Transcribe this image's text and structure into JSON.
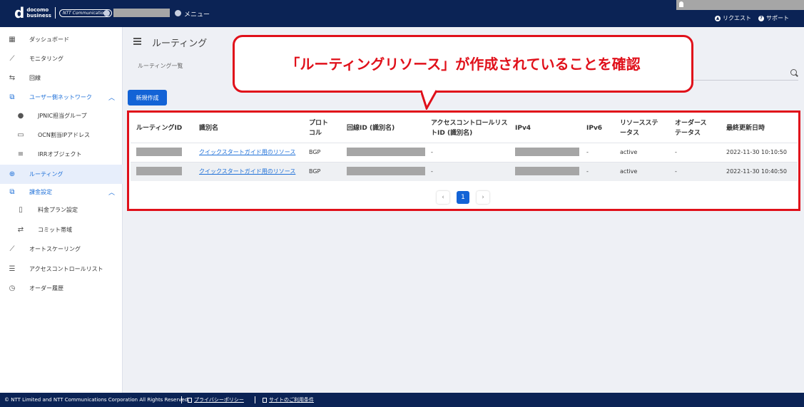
{
  "header": {
    "logo_main": "d",
    "logo_line1": "docomo",
    "logo_line2": "business",
    "logo_ntt": "NTT Communications",
    "menu_label": "メニュー",
    "request_label": "リクエスト",
    "support_label": "サポート"
  },
  "sidebar": {
    "items": [
      {
        "label": "ダッシュボード"
      },
      {
        "label": "モニタリング"
      },
      {
        "label": "回線"
      },
      {
        "label": "ユーザー側ネットワーク"
      },
      {
        "label": "JPNIC担当グループ"
      },
      {
        "label": "OCN割当IPアドレス"
      },
      {
        "label": "IRRオブジェクト"
      },
      {
        "label": "ルーティング"
      },
      {
        "label": "課金設定"
      },
      {
        "label": "料金プラン設定"
      },
      {
        "label": "コミット帯域"
      },
      {
        "label": "オートスケーリング"
      },
      {
        "label": "アクセスコントロールリスト"
      },
      {
        "label": "オーダー履歴"
      }
    ]
  },
  "page": {
    "title": "ルーティング",
    "breadcrumb": "ルーティング一覧",
    "new_button": "新規作成"
  },
  "table": {
    "headers": [
      "ルーティングID",
      "識別名",
      "プロトコル",
      "回線ID (識別名)",
      "アクセスコントロールリストID (識別名)",
      "IPv4",
      "IPv6",
      "リソースステータス",
      "オーダーステータス",
      "最終更新日時"
    ],
    "rows": [
      {
        "name": "クイックスタートガイド用のリソース",
        "protocol": "BGP",
        "acl": "-",
        "ipv6": "-",
        "resource_status": "active",
        "order_status": "-",
        "updated": "2022-11-30 10:10:50"
      },
      {
        "name": "クイックスタートガイド用のリソース",
        "protocol": "BGP",
        "acl": "-",
        "ipv6": "-",
        "resource_status": "active",
        "order_status": "-",
        "updated": "2022-11-30 10:40:50"
      }
    ]
  },
  "pagination": {
    "prev": "‹",
    "current": "1",
    "next": "›"
  },
  "callout": {
    "text": "「ルーティングリソース」が作成されていることを確認"
  },
  "footer": {
    "copyright": "© NTT Limited and NTT Communications Corporation All Rights Reserved.",
    "privacy": "プライバシーポリシー",
    "terms": "サイトのご利用条件"
  },
  "colors": {
    "header": "#0b2355",
    "accent": "#1d6fd8",
    "alert": "#e0101a"
  }
}
